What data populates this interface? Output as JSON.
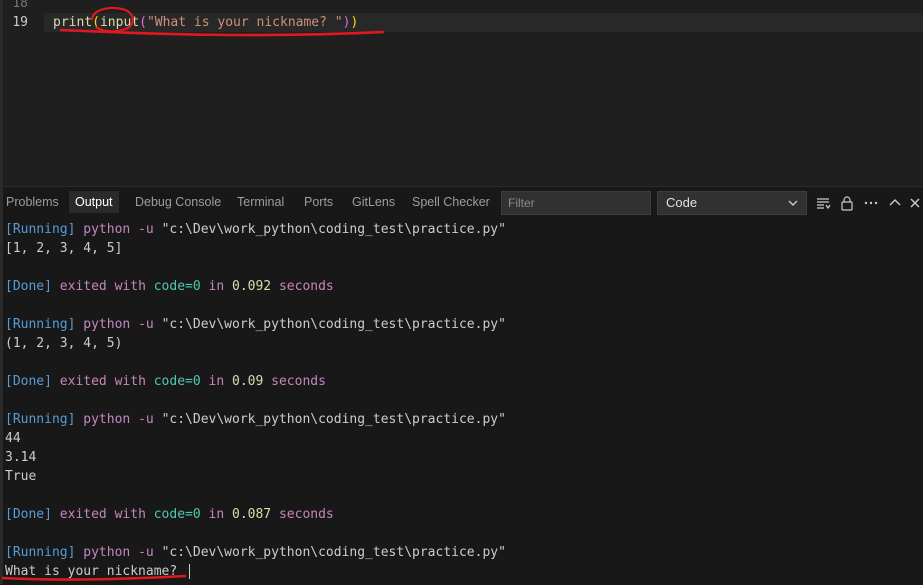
{
  "editor": {
    "lines": [
      {
        "number": "18",
        "active": false
      },
      {
        "number": "19",
        "active": true
      }
    ],
    "code": {
      "fn_print": "print",
      "paren_open_1": "(",
      "fn_input": "input",
      "paren_open_2": "(",
      "string": "\"What is your nickname? \"",
      "paren_close_2": ")",
      "paren_close_1": ")"
    }
  },
  "panel": {
    "tabs": [
      {
        "label": "Problems",
        "active": false
      },
      {
        "label": "Output",
        "active": true
      },
      {
        "label": "Debug Console",
        "active": false
      },
      {
        "label": "Terminal",
        "active": false
      },
      {
        "label": "Ports",
        "active": false
      },
      {
        "label": "GitLens",
        "active": false
      },
      {
        "label": "Spell Checker",
        "active": false
      }
    ],
    "filter_placeholder": "Filter",
    "channel": "Code",
    "icons": [
      "list-filter-icon",
      "lock-icon",
      "more-icon",
      "chevron-up-icon",
      "close-icon"
    ]
  },
  "output": [
    {
      "kind": "run",
      "tag": "[Running]",
      "cmd": "python -u",
      "path": "\"c:\\Dev\\work_python\\coding_test\\practice.py\""
    },
    {
      "kind": "text",
      "text": "[1, 2, 3, 4, 5]"
    },
    {
      "kind": "blank"
    },
    {
      "kind": "done",
      "tag": "[Done]",
      "pre": "exited with",
      "code": "code=0",
      "mid": "in",
      "secs": "0.092",
      "post": "seconds"
    },
    {
      "kind": "blank"
    },
    {
      "kind": "run",
      "tag": "[Running]",
      "cmd": "python -u",
      "path": "\"c:\\Dev\\work_python\\coding_test\\practice.py\""
    },
    {
      "kind": "text",
      "text": "(1, 2, 3, 4, 5)"
    },
    {
      "kind": "blank"
    },
    {
      "kind": "done",
      "tag": "[Done]",
      "pre": "exited with",
      "code": "code=0",
      "mid": "in",
      "secs": "0.09",
      "post": "seconds"
    },
    {
      "kind": "blank"
    },
    {
      "kind": "run",
      "tag": "[Running]",
      "cmd": "python -u",
      "path": "\"c:\\Dev\\work_python\\coding_test\\practice.py\""
    },
    {
      "kind": "text",
      "text": "44"
    },
    {
      "kind": "text",
      "text": "3.14"
    },
    {
      "kind": "text",
      "text": "True"
    },
    {
      "kind": "blank"
    },
    {
      "kind": "done",
      "tag": "[Done]",
      "pre": "exited with",
      "code": "code=0",
      "mid": "in",
      "secs": "0.087",
      "post": "seconds"
    },
    {
      "kind": "blank"
    },
    {
      "kind": "run",
      "tag": "[Running]",
      "cmd": "python -u",
      "path": "\"c:\\Dev\\work_python\\coding_test\\practice.py\""
    },
    {
      "kind": "prompt",
      "text": "What is your nickname? "
    }
  ],
  "colors": {
    "annotation": "#e0181f"
  }
}
